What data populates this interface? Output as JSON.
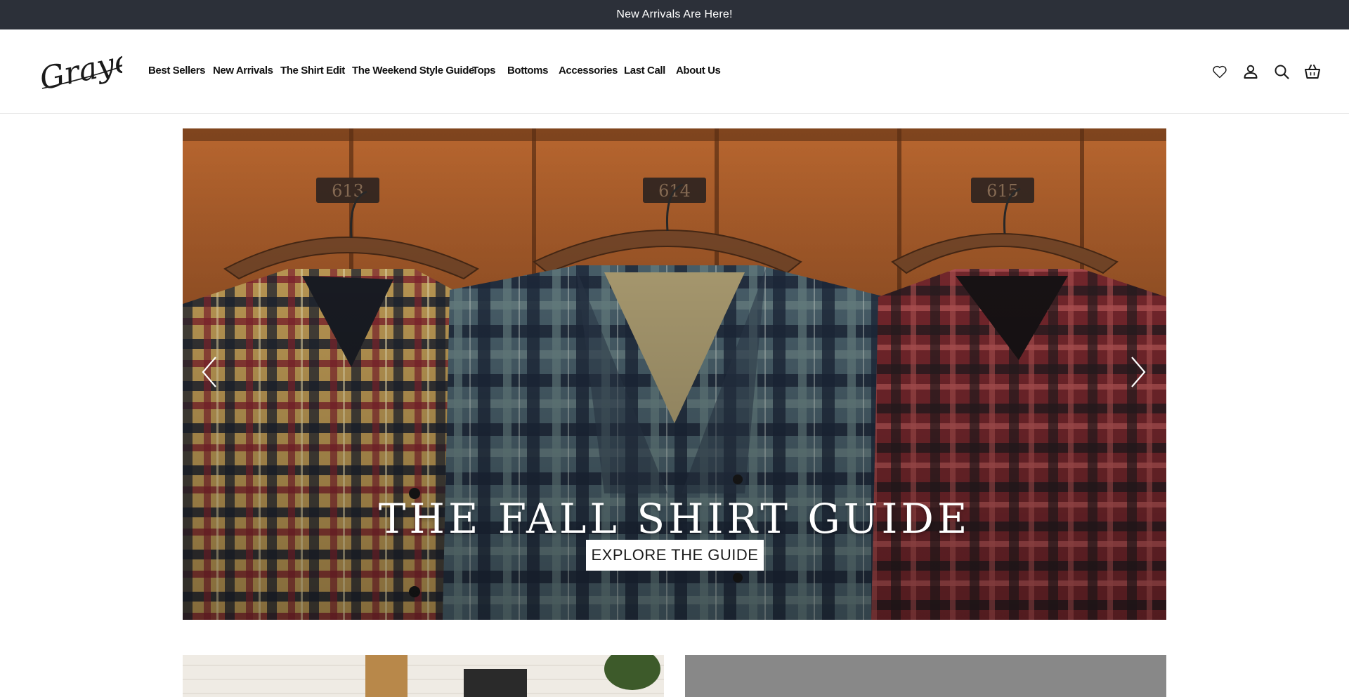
{
  "announcement": {
    "text": "New Arrivals Are Here!"
  },
  "brand": {
    "logo_text": "Grayers"
  },
  "nav": {
    "items": [
      {
        "label": "Best Sellers"
      },
      {
        "label": "New Arrivals"
      },
      {
        "label": "The Shirt Edit"
      },
      {
        "label": "The Weekend Style Guide"
      },
      {
        "label": "Tops"
      },
      {
        "label": "Bottoms"
      },
      {
        "label": "Accessories"
      },
      {
        "label": "Last Call"
      },
      {
        "label": "About Us"
      }
    ]
  },
  "header_icons": [
    "heart-icon",
    "account-icon",
    "search-icon",
    "cart-icon"
  ],
  "hero": {
    "title": "THE FALL SHIRT GUIDE",
    "cta_label": "EXPLORE THE GUIDE",
    "locker_numbers": [
      "613",
      "614",
      "615"
    ]
  },
  "colors": {
    "announcement_bg": "#2c3039",
    "locker_orange": "#b0612c",
    "text_dark": "#1a1a1a"
  }
}
